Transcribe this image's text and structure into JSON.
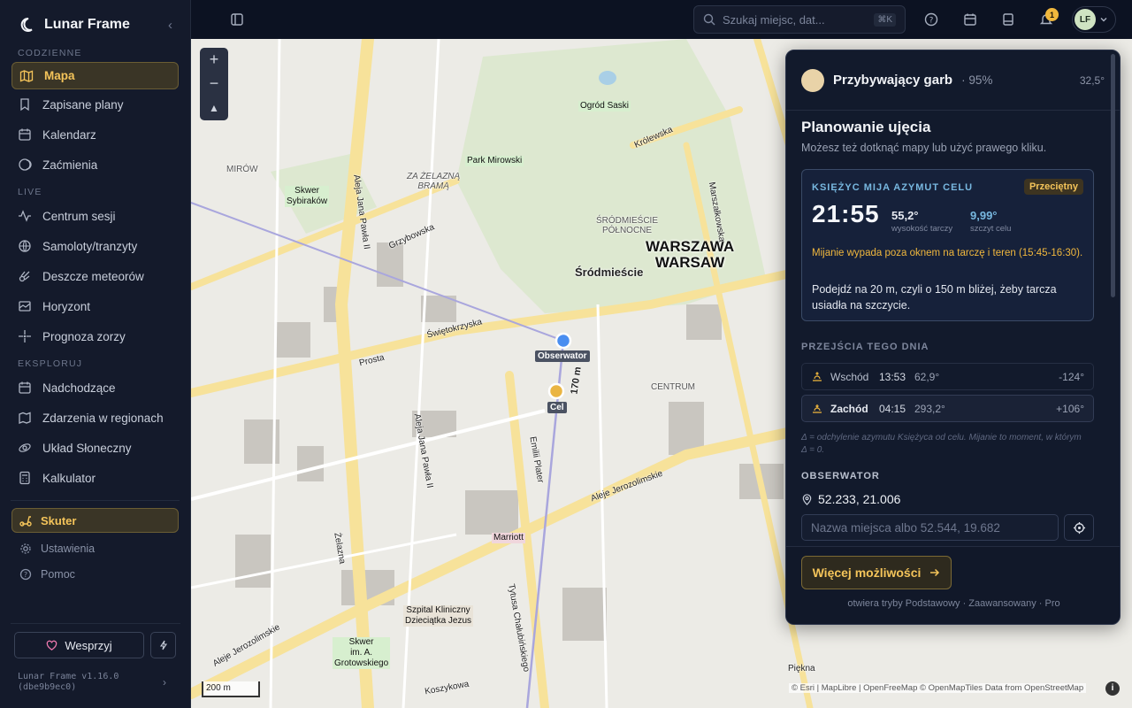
{
  "app": {
    "name": "Lunar Frame",
    "version": "Lunar Frame v1.16.0",
    "build": "(dbe9b9ec0)"
  },
  "sidebar": {
    "sections": [
      {
        "title": "CODZIENNE",
        "items": [
          {
            "label": "Mapa",
            "icon": "map-icon",
            "active": true
          },
          {
            "label": "Zapisane plany",
            "icon": "bookmark-icon"
          },
          {
            "label": "Kalendarz",
            "icon": "calendar-icon"
          },
          {
            "label": "Zaćmienia",
            "icon": "eclipse-icon"
          }
        ]
      },
      {
        "title": "LIVE",
        "items": [
          {
            "label": "Centrum sesji",
            "icon": "pulse-icon"
          },
          {
            "label": "Samoloty/tranzyty",
            "icon": "globe-icon"
          },
          {
            "label": "Deszcze meteorów",
            "icon": "meteor-icon"
          },
          {
            "label": "Horyzont",
            "icon": "horizon-icon"
          },
          {
            "label": "Prognoza zorzy",
            "icon": "sparkle-icon"
          }
        ]
      },
      {
        "title": "EKSPLORUJ",
        "items": [
          {
            "label": "Nadchodzące",
            "icon": "calendar-clock-icon"
          },
          {
            "label": "Zdarzenia w regionach",
            "icon": "map-pin-icon"
          },
          {
            "label": "Układ Słoneczny",
            "icon": "orbit-icon"
          },
          {
            "label": "Kalkulator",
            "icon": "calculator-icon"
          }
        ]
      }
    ],
    "scooter": "Skuter",
    "settings": "Ustawienia",
    "help": "Pomoc",
    "support": "Wesprzyj"
  },
  "topbar": {
    "search_placeholder": "Szukaj miejsc, dat...",
    "search_shortcut": "⌘K",
    "notifications_count": "1",
    "avatar_initials": "LF"
  },
  "map": {
    "labels": {
      "ogrod": "Ogród Saski",
      "mirowski": "Park Mirowski",
      "zelazna": "ZA ŻELAZNĄ\nBRAMĄ",
      "mirow": "MIRÓW",
      "sybirakow": "Skwer\nSybiraków",
      "polnocne": "ŚRÓDMIEŚCIE\nPÓŁNOCNE",
      "warszawa": "WARSZAWA\nWARSAW",
      "srodmiescie": "Śródmieście",
      "centrum": "CENTRUM",
      "marriott": "Marriott",
      "szpital": "Szpital Kliniczny\nDzieciątka Jezus",
      "skwer_grot": "Skwer\nim. A.\nGrotowskiego",
      "krolewska": "Królewska",
      "grzybowska": "Grzybowska",
      "swietokrzyska": "Świętokrzyska",
      "prosta": "Prosta",
      "jerozolimskie": "Aleje Jerozolimskie",
      "jerozolimskie2": "Aleje Jerozolimskie",
      "emilii": "Emilii Plater",
      "chalubinskiego": "Tytusa Chałubińskiego",
      "koszykowa": "Koszykowa",
      "jana_pawla": "Aleja Jana Pawła II",
      "jana_pawla2": "Aleja Jana Pawła II",
      "zelazna_st": "Żelazna",
      "marszalkowska": "Marszałkowska",
      "distance": "170 m",
      "piekna": "Piękna"
    },
    "observer": "Obserwator",
    "target": "Cel",
    "scale": "200 m",
    "attribution": "© Esri | MapLibre | OpenFreeMap © OpenMapTiles Data from OpenStreetMap",
    "info": "i"
  },
  "panel": {
    "phase_name": "Przybywający garb",
    "phase_pct": "· 95%",
    "phase_deg": "32,5°",
    "title": "Planowanie ujęcia",
    "subtitle": "Możesz też dotknąć mapy lub użyć prawego kliku.",
    "card": {
      "label": "KSIĘŻYC MIJA AZYMUT CELU",
      "badge": "Przeciętny",
      "time": "21:55",
      "alt_value": "55,2°",
      "alt_label": "wysokość tarczy",
      "peak_value": "9,99°",
      "peak_label": "szczyt celu",
      "warning": "Mijanie wypada poza oknem na tarczę i teren (15:45-16:30).",
      "advice": "Podejdź na 20 m, czyli o 150 m bliżej, żeby tarcza usiadła na szczycie."
    },
    "transits_title": "PRZEJŚCIA TEGO DNIA",
    "transits": [
      {
        "name": "Wschód",
        "time": "13:53",
        "az": "62,9°",
        "delta": "-124°"
      },
      {
        "name": "Zachód",
        "time": "04:15",
        "az": "293,2°",
        "delta": "+106°"
      }
    ],
    "note": "Δ = odchylenie azymutu Księżyca od celu. Mijanie to moment, w którym Δ = 0.",
    "observer_title": "OBSERWATOR",
    "coords": "52.233, 21.006",
    "place_placeholder": "Nazwa miejsca albo 52.544, 19.682",
    "more_button": "Więcej możliwości",
    "footer": "otwiera tryby Podstawowy · Zaawansowany · Pro"
  },
  "colors": {
    "accent": "#f4c45a",
    "sidebar_bg": "#141a2b",
    "panel_bg": "#121a2c",
    "info_blue": "#78b8e0"
  }
}
